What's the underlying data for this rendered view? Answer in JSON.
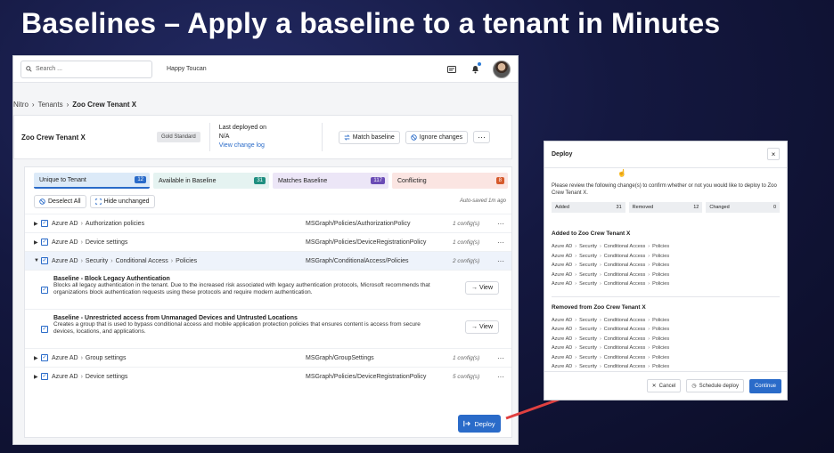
{
  "slide": {
    "title": "Baselines – Apply a baseline to a tenant in Minutes"
  },
  "topbar": {
    "search_placeholder": "Search ...",
    "org_name": "Happy Toucan"
  },
  "breadcrumb": [
    "Nitro",
    "Tenants",
    "Zoo Crew Tenant X"
  ],
  "tenant": {
    "name": "Zoo Crew Tenant X",
    "baseline_badge": "Gold Standard",
    "last_deployed_label": "Last deployed on",
    "last_deployed_value": "N/A",
    "change_log_link": "View change log",
    "match_baseline": "Match baseline",
    "ignore_changes": "Ignore changes",
    "more": "···"
  },
  "tabs": [
    {
      "label": "Unique to Tenant",
      "count": "12"
    },
    {
      "label": "Available in Baseline",
      "count": "31"
    },
    {
      "label": "Matches Baseline",
      "count": "117"
    },
    {
      "label": "Conflicting",
      "count": "8"
    }
  ],
  "tools": {
    "deselect_all": "Deselect All",
    "hide_unchanged": "Hide unchanged",
    "autosaved": "Auto-saved 1m ago"
  },
  "rows": [
    {
      "root": "Azure AD",
      "path": [
        "Authorization policies"
      ],
      "graph": "MSGraph/Policies/AuthorizationPolicy",
      "count": "1 config(s)"
    },
    {
      "root": "Azure AD",
      "path": [
        "Device settings"
      ],
      "graph": "MSGraph/Policies/DeviceRegistrationPolicy",
      "count": "1 config(s)"
    },
    {
      "root": "Azure AD",
      "path": [
        "Security",
        "Conditional Access",
        "Policies"
      ],
      "graph": "MSGraph/ConditionalAccess/Policies",
      "count": "2 config(s)"
    },
    {
      "root": "Azure AD",
      "path": [
        "Group settings"
      ],
      "graph": "MSGraph/GroupSettings",
      "count": "1 config(s)"
    },
    {
      "root": "Azure AD",
      "path": [
        "Device settings"
      ],
      "graph": "MSGraph/Policies/DeviceRegistrationPolicy",
      "count": "5 config(s)"
    }
  ],
  "policies": [
    {
      "title": "Baseline - Block Legacy Authentication",
      "desc": "Blocks all legacy authentication in the tenant. Due to the increased risk associated with legacy authentication protocols, Microsoft recommends that organizations block authentication requests using these protocols and require modern authentication.",
      "view": "View"
    },
    {
      "title": "Baseline - Unrestricted access from Unmanaged Devices and Untrusted Locations",
      "desc": "Creates a group that is used to bypass conditional access and mobile application protection policies that ensures content is access from secure devices, locations, and applications.",
      "view": "View"
    }
  ],
  "deploy_button": "Deploy",
  "dialog": {
    "title": "Deploy",
    "close": "×",
    "intro": "Please review the following change(s) to confirm whether or not you would like to deploy to Zoo Crew Tenant X.",
    "stats": [
      {
        "label": "Added",
        "value": "31"
      },
      {
        "label": "Removed",
        "value": "12"
      },
      {
        "label": "Changed",
        "value": "0"
      }
    ],
    "added_title": "Added to Zoo Crew Tenant X",
    "removed_title": "Removed from Zoo Crew Tenant X",
    "change_path": [
      "Azure AD",
      "Security",
      "Conditional Access",
      "Policies"
    ],
    "added_count": 5,
    "removed_count": 6,
    "cancel": "Cancel",
    "schedule": "Schedule deploy",
    "continue": "Continue"
  },
  "colors": {
    "accent": "#2a6bc9",
    "arrow": "#e04040"
  }
}
